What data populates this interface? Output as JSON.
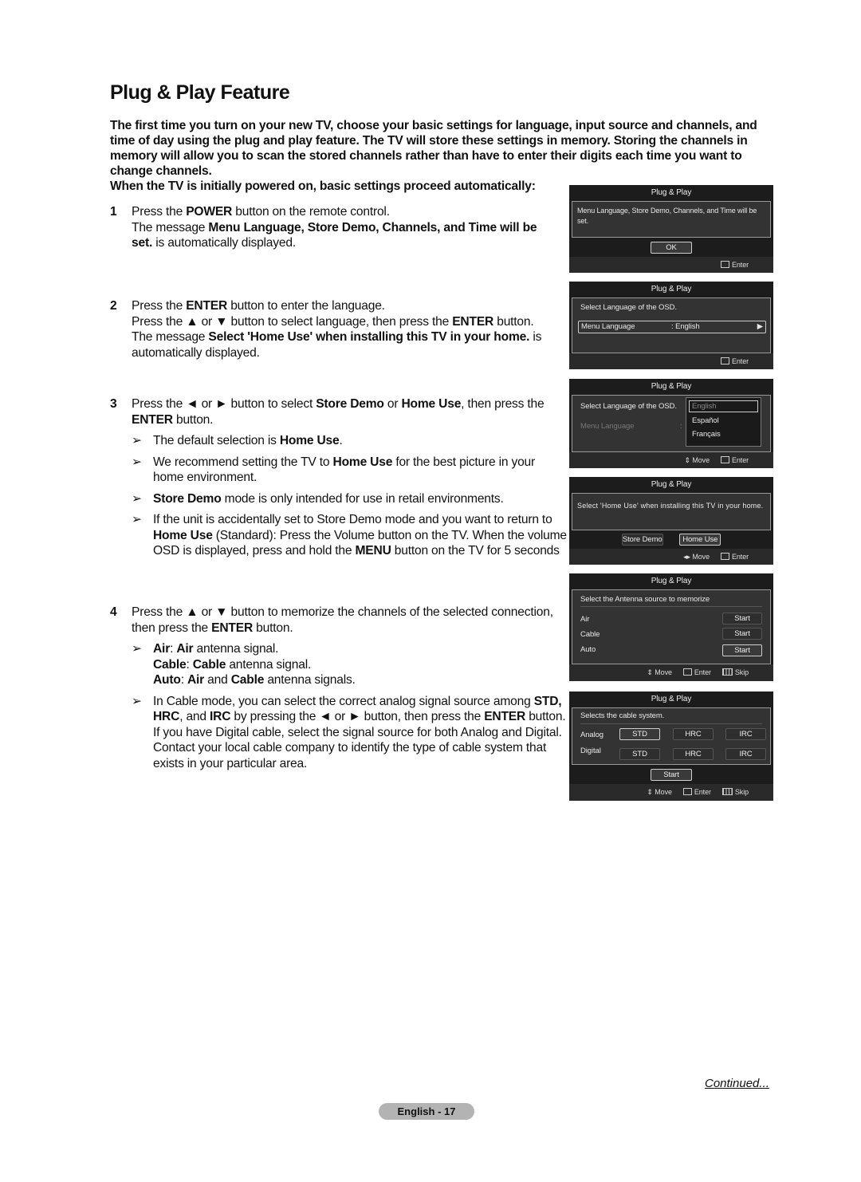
{
  "page": {
    "title": "Plug & Play Feature",
    "intro": "The first time you turn on your new TV, choose your basic settings for language, input source and channels, and time of day using the plug and play feature. The TV will store these settings in memory. Storing the channels in memory will allow you to scan the stored channels rather than have to enter their digits each time you want to change channels.",
    "intro2": "When the TV is initially powered on, basic settings proceed automatically:",
    "continued": "Continued...",
    "page_number": "English - 17"
  },
  "steps": [
    {
      "num": "1",
      "t1": "Press the ",
      "b1": "POWER",
      "t2": " button on the remote control.",
      "t3": "The message ",
      "b2": "Menu Language, Store Demo, Channels, and Time will be set.",
      "t4": " is automatically displayed."
    },
    {
      "num": "2",
      "t1": "Press the ",
      "b1": "ENTER",
      "t2": " button to enter the language.",
      "t3": "Press the ▲ or ▼ button to select language, then press the ",
      "b2": "ENTER",
      "t4": " button.",
      "t5": "The message ",
      "b3": "Select 'Home Use' when installing this TV in your home.",
      "t6": " is automatically displayed."
    },
    {
      "num": "3",
      "t1": "Press the ◄ or ► button to select ",
      "b1": "Store Demo",
      "t2": " or ",
      "b2": "Home Use",
      "t3": ", then press the ",
      "b3": "ENTER",
      "t4": " button.",
      "notes": [
        {
          "t1": "The default selection is ",
          "b1": "Home Use",
          "t2": "."
        },
        {
          "t1": "We recommend setting the TV to ",
          "b1": "Home Use",
          "t2": " for the best picture in your home environment."
        },
        {
          "b1": "Store Demo",
          "t2": " mode is only intended for use in retail environments."
        },
        {
          "t1": "If the unit is accidentally set to Store Demo mode and you want to return to ",
          "b1": "Home Use",
          "t2": " (Standard): Press the Volume button on the TV. When the volume OSD is displayed, press and hold the ",
          "b2": "MENU",
          "t3": " button on the TV for 5 seconds"
        }
      ]
    },
    {
      "num": "4",
      "t1": "Press the ▲ or ▼ button to memorize the channels of the selected connection, then press the ",
      "b1": "ENTER",
      "t2": " button.",
      "notes": [
        {
          "l1b": "Air",
          "l1a": ": ",
          "l1c": "Air",
          "l1d": " antenna signal.",
          "l2b": "Cable",
          "l2a": ": ",
          "l2c": "Cable",
          "l2d": " antenna signal.",
          "l3b": "Auto",
          "l3a": ": ",
          "l3c": "Air",
          "l3d": " and ",
          "l3e": "Cable",
          "l3f": " antenna signals."
        },
        {
          "t1": "In Cable mode, you can select the correct analog signal source among ",
          "b1": "STD, HRC",
          "t2": ", and ",
          "b2": "IRC",
          "t3": " by pressing the ◄ or ► button, then press the ",
          "b3": "ENTER",
          "t4": " button. If you have Digital cable, select the signal source for both Analog and Digital. Contact your local cable company to identify the type of cable system that exists in your particular area."
        }
      ]
    }
  ],
  "note_arrow": "➢",
  "osd": {
    "header": "Plug & Play",
    "enter": "Enter",
    "move": "Move",
    "skip": "Skip",
    "s1": {
      "message": "Menu Language, Store Demo, Channels, and Time will be set.",
      "ok": "OK"
    },
    "s2": {
      "prompt": "Select Language of the OSD.",
      "label": "Menu Language",
      "value": ": English",
      "arrow": "▶"
    },
    "s3": {
      "prompt": "Select Language of the OSD.",
      "label": "Menu Language",
      "colon": ":",
      "options": [
        "English",
        "Español",
        "Français"
      ]
    },
    "s4": {
      "message": "Select 'Home Use' when installing this TV in your home.",
      "store_demo": "Store Demo",
      "home_use": "Home Use"
    },
    "s5": {
      "prompt": "Select the Antenna source to memorize",
      "rows": [
        "Air",
        "Cable",
        "Auto"
      ],
      "start": "Start"
    },
    "s6": {
      "prompt": "Selects the cable system.",
      "analog": "Analog",
      "digital": "Digital",
      "options": [
        "STD",
        "HRC",
        "IRC"
      ],
      "start": "Start"
    }
  }
}
